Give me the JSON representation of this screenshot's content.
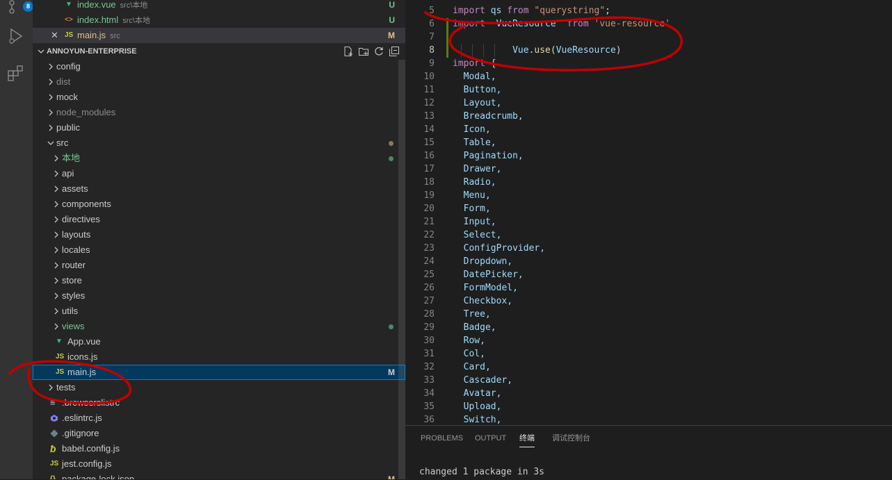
{
  "activity_bar": {
    "scm_badge": "8"
  },
  "open_editors": [
    {
      "name": "index.vue",
      "desc": "src\\本地",
      "status": "U"
    },
    {
      "name": "index.html",
      "desc": "src\\本地",
      "status": "U"
    },
    {
      "name": "main.js",
      "desc": "src",
      "status": "M"
    }
  ],
  "explorer": {
    "title": "ANNOYUN-ENTERPRISE",
    "items": [
      {
        "label": "config"
      },
      {
        "label": "dist"
      },
      {
        "label": "mock"
      },
      {
        "label": "node_modules"
      },
      {
        "label": "public"
      },
      {
        "label": "src"
      },
      {
        "label": "本地"
      },
      {
        "label": "api"
      },
      {
        "label": "assets"
      },
      {
        "label": "components"
      },
      {
        "label": "directives"
      },
      {
        "label": "layouts"
      },
      {
        "label": "locales"
      },
      {
        "label": "router"
      },
      {
        "label": "store"
      },
      {
        "label": "styles"
      },
      {
        "label": "utils"
      },
      {
        "label": "views"
      },
      {
        "label": "App.vue"
      },
      {
        "label": "icons.js"
      },
      {
        "label": "main.js",
        "status": "M"
      },
      {
        "label": "tests"
      },
      {
        "label": ".browserslistrc"
      },
      {
        "label": ".eslintrc.js"
      },
      {
        "label": ".gitignore"
      },
      {
        "label": "babel.config.js"
      },
      {
        "label": "jest.config.js"
      },
      {
        "label": "package-lock.json",
        "status": "M"
      }
    ],
    "icon_text": {
      "js": "JS"
    }
  },
  "editor": {
    "line_numbers": [
      "5",
      "6",
      "7",
      "8",
      "9",
      "10",
      "11",
      "12",
      "13",
      "14",
      "15",
      "16",
      "17",
      "18",
      "19",
      "20",
      "21",
      "22",
      "23",
      "24",
      "25",
      "26",
      "27",
      "28",
      "29",
      "30",
      "31",
      "32",
      "33",
      "34",
      "35",
      "36"
    ],
    "line5": {
      "kw": "import",
      "id": "qs",
      "from": "from",
      "str": "\"querystring\"",
      "end": ";"
    },
    "line6": {
      "kw": "import",
      "id": "VueResource",
      "from": "from",
      "str": "'vue-resource'"
    },
    "line8": {
      "obj": "Vue",
      "dot": ".",
      "fn": "use",
      "p1": "(",
      "arg": "VueResource",
      "p2": ")"
    },
    "line9": {
      "kw": "import",
      "rest": " {"
    },
    "members": [
      "Modal,",
      "Button,",
      "Layout,",
      "Breadcrumb,",
      "Icon,",
      "Table,",
      "Pagination,",
      "Drawer,",
      "Radio,",
      "Menu,",
      "Form,",
      "Input,",
      "Select,",
      "ConfigProvider,",
      "Dropdown,",
      "DatePicker,",
      "FormModel,",
      "Checkbox,",
      "Tree,",
      "Badge,",
      "Row,",
      "Col,",
      "Card,",
      "Cascader,",
      "Avatar,",
      "Upload,",
      "Switch,"
    ]
  },
  "panel": {
    "tabs": [
      "PROBLEMS",
      "OUTPUT",
      "终端",
      "调试控制台"
    ],
    "terminal_line": "changed 1 package in 3s"
  },
  "colors": {
    "modified": "#e2c08d",
    "untracked": "#73c991",
    "annotation": "#c00000"
  }
}
